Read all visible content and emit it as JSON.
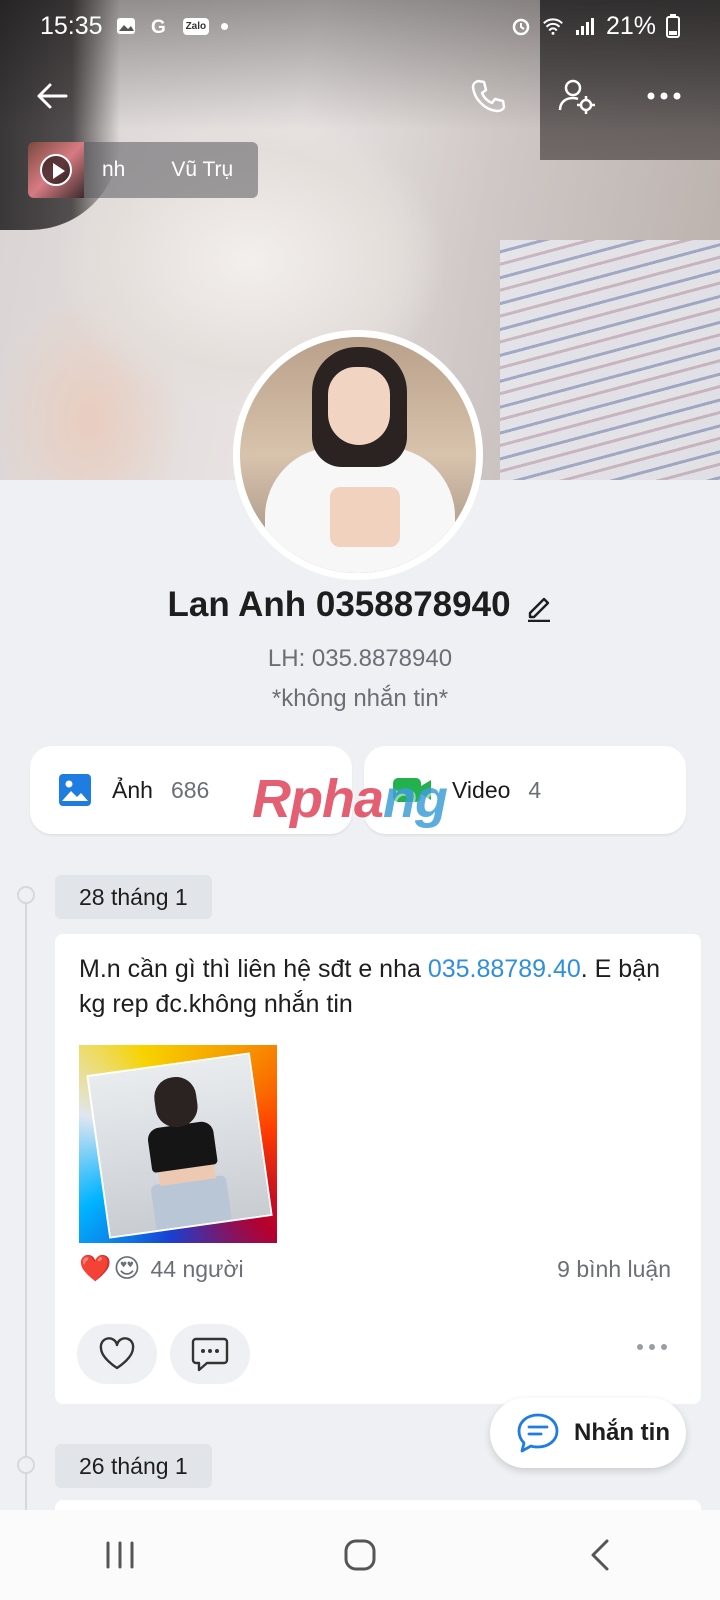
{
  "status_bar": {
    "time": "15:35",
    "battery": "21%",
    "notification_icons": [
      "gallery-icon",
      "google-icon",
      "zalo-icon",
      "dot"
    ],
    "zalo_label": "Zalo"
  },
  "header": {
    "back_icon": "arrow-left-icon",
    "call_icon": "phone-icon",
    "settings_icon": "user-settings-icon",
    "more_icon": "more-horizontal-icon"
  },
  "music": {
    "title_part1": "nh",
    "title_part2": "Vũ Trụ"
  },
  "profile": {
    "name": "Lan Anh 0358878940",
    "bio_line1": "LH: 035.8878940",
    "bio_line2": "*không nhắn tin*"
  },
  "media": {
    "photos_label": "Ảnh",
    "photos_count": "686",
    "videos_label": "Video",
    "videos_count": "4",
    "watermark_text_a": "Rpha",
    "watermark_text_b": "ng"
  },
  "timeline": {
    "dates": [
      "28 tháng 1",
      "26 tháng 1"
    ],
    "post": {
      "text_before": "M.n cần gì thì liên hệ sđt e nha ",
      "phone_link": "035.88789.40",
      "text_after": ". E bận kg rep đc.không nhắn tin",
      "reactions_emoji": [
        "❤️",
        "😍"
      ],
      "reactions_count": "44 người",
      "comments_count": "9 bình luận"
    }
  },
  "fab": {
    "label": "Nhắn tin"
  },
  "colors": {
    "accent_blue": "#2f8fdb",
    "photo_icon_blue": "#1f7ce0",
    "video_icon_green": "#22b14c",
    "background": "#eef0f3"
  }
}
